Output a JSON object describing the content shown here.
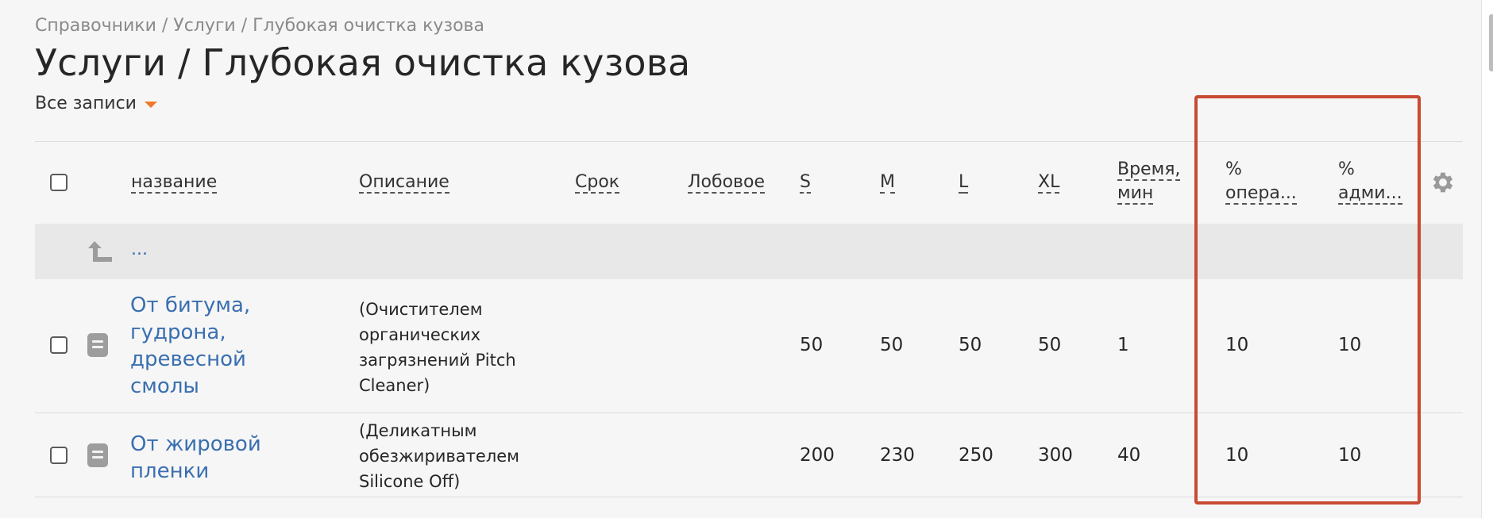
{
  "breadcrumb": "Справочники / Услуги / Глубокая очистка кузова",
  "page_title": "Услуги / Глубокая очистка кузова",
  "filter_label": "Все записи",
  "columns": {
    "name": "название",
    "description": "Описание",
    "term": "Срок",
    "front": "Лобовое",
    "s": "S",
    "m": "M",
    "l": "L",
    "xl": "XL",
    "time_line1": "Время,",
    "time_line2": "мин",
    "op_line1": "%",
    "op_line2": "опера...",
    "admin_line1": "%",
    "admin_line2": "адми..."
  },
  "up_row_label": "...",
  "rows": [
    {
      "name_lines": [
        "От битума,",
        "гудрона,",
        "древесной",
        "смолы"
      ],
      "desc_lines": [
        "(Очистителем",
        "органических",
        "загрязнений Pitch",
        "Cleaner)"
      ],
      "term": "",
      "front": "",
      "s": "50",
      "m": "50",
      "l": "50",
      "xl": "50",
      "time": "1",
      "op": "10",
      "admin": "10"
    },
    {
      "name_lines": [
        "От жировой",
        "пленки"
      ],
      "desc_lines": [
        "(Деликатным",
        "обезжиривателем",
        "Silicone Off)"
      ],
      "term": "",
      "front": "",
      "s": "200",
      "m": "230",
      "l": "250",
      "xl": "300",
      "time": "40",
      "op": "10",
      "admin": "10"
    }
  ],
  "icons": {
    "up": "arrow-up-left-icon",
    "doc": "document-icon",
    "gear": "gear-icon"
  },
  "colors": {
    "link": "#3a6fb0",
    "caret": "#f07a2a",
    "highlight": "#c94a33"
  }
}
